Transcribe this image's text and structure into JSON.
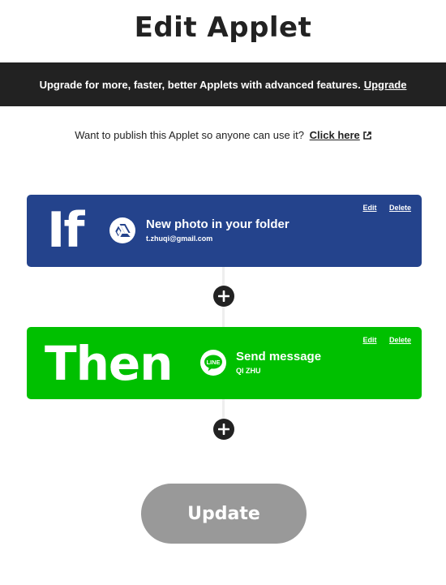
{
  "page": {
    "title": "Edit Applet"
  },
  "banner": {
    "text": "Upgrade for more, faster, better Applets with advanced features.",
    "link": "Upgrade"
  },
  "publish": {
    "text": "Want to publish this Applet so anyone can use it?",
    "link": "Click here"
  },
  "trigger": {
    "keyword": "If",
    "title": "New photo in your folder",
    "account": "t.zhuqi@gmail.com",
    "service_icon": "google-drive-icon",
    "color": "#24438c",
    "edit": "Edit",
    "delete": "Delete"
  },
  "action": {
    "keyword": "Then",
    "title": "Send message",
    "account": "QI ZHU",
    "service_icon": "line-icon",
    "service_icon_text": "LINE",
    "color": "#00c000",
    "edit": "Edit",
    "delete": "Delete"
  },
  "update_button": {
    "label": "Update"
  },
  "colors": {
    "banner": "#222222",
    "update_disabled": "#999999"
  }
}
